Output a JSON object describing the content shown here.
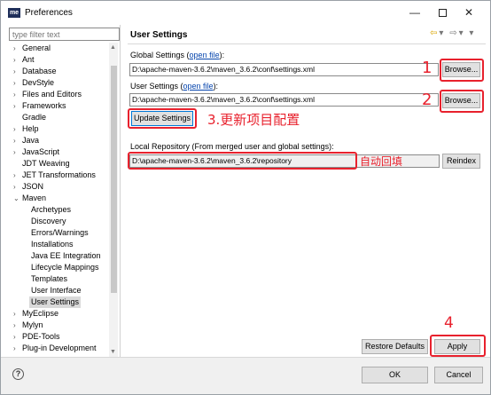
{
  "window": {
    "title": "Preferences",
    "app_icon_text": "me",
    "minimize": "—",
    "close": "✕"
  },
  "filter": {
    "placeholder": "type filter text"
  },
  "tree": [
    {
      "label": "General",
      "expanded": false,
      "level": 0
    },
    {
      "label": "Ant",
      "expanded": false,
      "level": 0
    },
    {
      "label": "Database",
      "expanded": false,
      "level": 0
    },
    {
      "label": "DevStyle",
      "expanded": false,
      "level": 0
    },
    {
      "label": "Files and Editors",
      "expanded": false,
      "level": 0
    },
    {
      "label": "Frameworks",
      "expanded": false,
      "level": 0
    },
    {
      "label": "Gradle",
      "level": 0
    },
    {
      "label": "Help",
      "expanded": false,
      "level": 0
    },
    {
      "label": "Java",
      "expanded": false,
      "level": 0
    },
    {
      "label": "JavaScript",
      "expanded": false,
      "level": 0
    },
    {
      "label": "JDT Weaving",
      "level": 0
    },
    {
      "label": "JET Transformations",
      "expanded": false,
      "level": 0
    },
    {
      "label": "JSON",
      "expanded": false,
      "level": 0
    },
    {
      "label": "Maven",
      "expanded": true,
      "level": 0
    },
    {
      "label": "Archetypes",
      "level": 1
    },
    {
      "label": "Discovery",
      "level": 1
    },
    {
      "label": "Errors/Warnings",
      "level": 1
    },
    {
      "label": "Installations",
      "level": 1
    },
    {
      "label": "Java EE Integration",
      "level": 1
    },
    {
      "label": "Lifecycle Mappings",
      "level": 1
    },
    {
      "label": "Templates",
      "level": 1
    },
    {
      "label": "User Interface",
      "level": 1
    },
    {
      "label": "User Settings",
      "level": 1,
      "selected": true
    },
    {
      "label": "MyEclipse",
      "expanded": false,
      "level": 0
    },
    {
      "label": "Mylyn",
      "expanded": false,
      "level": 0
    },
    {
      "label": "PDE-Tools",
      "expanded": false,
      "level": 0
    },
    {
      "label": "Plug-in Development",
      "expanded": false,
      "level": 0
    }
  ],
  "page": {
    "title": "User Settings",
    "nav_back": "⇦",
    "nav_forward": "⇨",
    "nav_menu": "▾",
    "global_label_before": "Global Settings (",
    "global_link": "open file",
    "global_label_after": "):",
    "global_path": "D:\\apache-maven-3.6.2\\maven_3.6.2\\conf\\settings.xml",
    "user_label_before": "User Settings (",
    "user_link": "open file",
    "user_label_after": "):",
    "user_path": "D:\\apache-maven-3.6.2\\maven_3.6.2\\conf\\settings.xml",
    "browse_label": "Browse...",
    "update_label": "Update Settings",
    "local_repo_label": "Local Repository (From merged user and global settings):",
    "local_repo_path": "D:\\apache-maven-3.6.2\\maven_3.6.2\\repository",
    "reindex_label": "Reindex",
    "restore_label": "Restore Defaults",
    "apply_label": "Apply"
  },
  "annotations": {
    "n1": "1",
    "n2": "2",
    "n3": "3.更新项目配置",
    "auto_fill": "自动回填",
    "n4": "4",
    "color": "#e8212d"
  },
  "footer": {
    "help": "?",
    "ok_label": "OK",
    "cancel_label": "Cancel"
  }
}
